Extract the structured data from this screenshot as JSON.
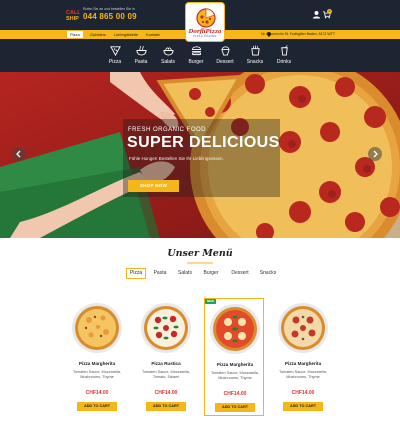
{
  "header": {
    "call_small": "Rufen Sie an und bestellen Sie in",
    "phone": "044 865 00 09",
    "logo_name": "DorfliPizza",
    "logo_sub": "PIZZA KURIER",
    "address": "Nr 4&uuml;rrin St. Furthgifen Baden, 8172 WTT",
    "cart_count": "0"
  },
  "nav": {
    "items": [
      "Pizza",
      "Gutcbins",
      "Liefergäbleite",
      "Kontakt"
    ],
    "active": "Pizza"
  },
  "categories": [
    "Pizza",
    "Pasta",
    "Salats",
    "Burger",
    "Dessert",
    "Snacks",
    "Drinks"
  ],
  "hero": {
    "kicker": "FRESH ORGANIC FOOD",
    "title": "SUPER DELICIOUS",
    "text": "Fühle Hunger! Bestellen Sie Ihr Lieblingsessen.",
    "button": "SHOP NOW"
  },
  "menu": {
    "title": "Unser Menü",
    "tabs": [
      "Pizza",
      "Pasta",
      "Salats",
      "Burger",
      "Dessert",
      "Snacks"
    ],
    "active_tab": "Pizza",
    "products": [
      {
        "name": "Pizza Margherita",
        "desc": "Tomaten Sauce, Mozzarella, Mushrooms, Thyme",
        "price": "CHF14.00",
        "button": "ADD TO CART"
      },
      {
        "name": "Pizza Rustica",
        "desc": "Tomaten Sauce, Mozzarella, Tomato, Salami",
        "price": "CHF14.00",
        "button": "ADD TO CART"
      },
      {
        "name": "Pizza Margherita",
        "desc": "Tomaten Sauce, Mozzarella, Mushrooms, Thyme",
        "price": "CHF14.00",
        "button": "ADD TO CART",
        "badge": "NEW"
      },
      {
        "name": "Pizza Margherita",
        "desc": "Tomaten Sauce, Mozzarella, Mushrooms, Thyme",
        "price": "CHF14.00",
        "button": "ADD TO CART"
      }
    ]
  },
  "colors": {
    "dark": "#1d2432",
    "accent": "#f5b619",
    "price": "#dd3333"
  }
}
